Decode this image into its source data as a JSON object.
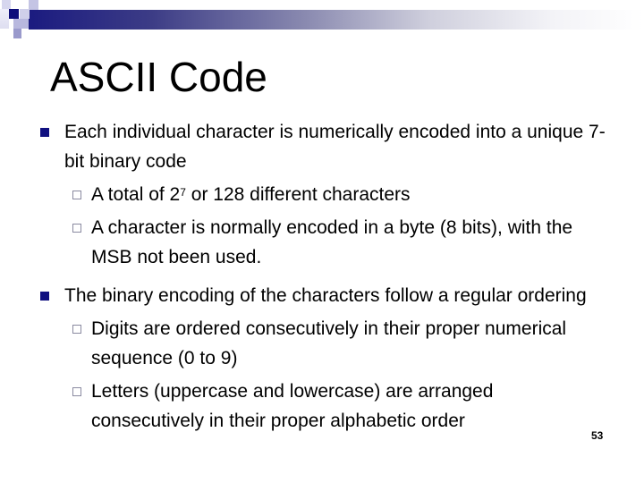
{
  "slide": {
    "title": "ASCII Code",
    "page_number": "53",
    "accent_color": "#1b1b80",
    "bullets": [
      {
        "text": "Each individual character is numerically encoded into a unique 7-bit binary code",
        "sub": [
          {
            "pre": "A total of 2",
            "sup": "7",
            "post": " or 128 different characters"
          },
          {
            "text": "A character is normally encoded in a byte (8 bits), with the MSB not been used."
          }
        ]
      },
      {
        "text": "The binary encoding of the characters follow a regular ordering",
        "sub": [
          {
            "text": "Digits are ordered consecutively in their proper numerical sequence (0 to 9)"
          },
          {
            "text": "Letters (uppercase and lowercase) are arranged consecutively in their proper alphabetic order"
          }
        ]
      }
    ]
  }
}
